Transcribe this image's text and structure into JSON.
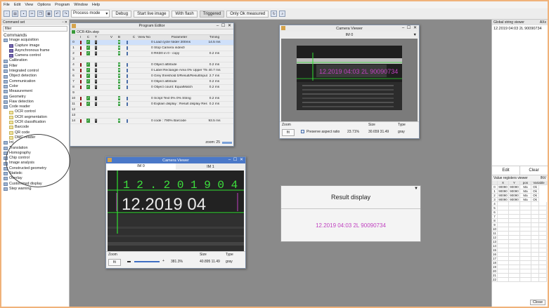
{
  "menu": [
    "File",
    "Edit",
    "View",
    "Options",
    "Program",
    "Window",
    "Help"
  ],
  "toolbar": {
    "icons": [
      "new-icon",
      "open-icon",
      "save-icon",
      "cut-icon",
      "copy-icon",
      "paste-icon",
      "undo-icon",
      "redo-icon"
    ],
    "mode_select": "Process mode",
    "debug_btn": "Debug",
    "start_live_btn": "Start live image",
    "flash_btn": "With flash",
    "triggered_btn": "Triggered",
    "only_ok_btn": "Only Ok measured"
  },
  "left_panel": {
    "title": "Command set",
    "filter": "filter",
    "items": [
      {
        "label": "Commands",
        "level": 0,
        "icon": "none",
        "kind": "hdr"
      },
      {
        "label": "Image acquisition",
        "level": 0,
        "icon": "folder-icon"
      },
      {
        "label": "Capture image",
        "level": 1,
        "icon": "image-icon"
      },
      {
        "label": "Asynchronous frame",
        "level": 1,
        "icon": "image-icon"
      },
      {
        "label": "Camera control",
        "level": 1,
        "icon": "image-icon"
      },
      {
        "label": "Calibration",
        "level": 0,
        "icon": "folder-icon"
      },
      {
        "label": "Filter",
        "level": 0,
        "icon": "folder-icon"
      },
      {
        "label": "Integrated control",
        "level": 0,
        "icon": "folder-icon"
      },
      {
        "label": "Object detection",
        "level": 0,
        "icon": "folder-icon"
      },
      {
        "label": "Communication",
        "level": 0,
        "icon": "folder-icon"
      },
      {
        "label": "Color",
        "level": 0,
        "icon": "folder-icon"
      },
      {
        "label": "Measurement",
        "level": 0,
        "icon": "folder-icon"
      },
      {
        "label": "Geometry",
        "level": 0,
        "icon": "folder-icon"
      },
      {
        "label": "Flaw detection",
        "level": 0,
        "icon": "folder-icon"
      },
      {
        "label": "Code reader",
        "level": 0,
        "icon": "folder-icon"
      },
      {
        "label": "OCR control",
        "level": 1,
        "icon": "code-icon"
      },
      {
        "label": "OCR segmentation",
        "level": 1,
        "icon": "code-icon"
      },
      {
        "label": "OCR classification",
        "level": 1,
        "icon": "code-icon"
      },
      {
        "label": "Barcode",
        "level": 1,
        "icon": "code-icon"
      },
      {
        "label": "QR code",
        "level": 1,
        "icon": "code-icon"
      },
      {
        "label": "DMC reader",
        "level": 1,
        "icon": "code-icon"
      },
      {
        "label": "Int",
        "level": 0,
        "icon": "folder-icon"
      },
      {
        "label": "Translation",
        "level": 0,
        "icon": "folder-icon"
      },
      {
        "label": "Homography",
        "level": 0,
        "icon": "folder-icon"
      },
      {
        "label": "Chip control",
        "level": 0,
        "icon": "folder-icon"
      },
      {
        "label": "Image analysis",
        "level": 0,
        "icon": "folder-icon"
      },
      {
        "label": "Constructed geometry",
        "level": 0,
        "icon": "folder-icon"
      },
      {
        "label": "Statistic",
        "level": 0,
        "icon": "folder-icon"
      },
      {
        "label": "Overlay",
        "level": 0,
        "icon": "folder-icon"
      },
      {
        "label": "Customized display",
        "level": 0,
        "icon": "folder-icon"
      },
      {
        "label": "Step warning",
        "level": 0,
        "icon": "folder-icon"
      }
    ]
  },
  "program_editor": {
    "title": "Program Editor",
    "file": "OCR-Kiln.step",
    "headers": [
      "I",
      "C",
      "T",
      "",
      "V",
      "B",
      "",
      "C",
      "View No",
      "Parameter",
      "Timing"
    ],
    "rows": [
      {
        "n": "0",
        "text": "0 Load cycle folder 200ms",
        "t": "14.5 ms",
        "sel": true
      },
      {
        "n": "1",
        "text": "0 Stop Camera index0",
        "t": "",
        "sel": false
      },
      {
        "n": "2",
        "text": "0 RKD0 in 0 - copy",
        "t": "0.2 ms",
        "sel": false
      },
      {
        "n": "3",
        "text": "",
        "t": "",
        "sel": false
      },
      {
        "n": "4",
        "text": "0 Object attribute",
        "t": "0.2 ms",
        "sel": false
      },
      {
        "n": "5",
        "text": "0 Label Rectangle Area 0% Upper Threshold",
        "t": "40.7 ms",
        "sel": false
      },
      {
        "n": "6",
        "text": "0 Grey threshold 0/Result/ResultInput",
        "t": "2.7 ms",
        "sel": false
      },
      {
        "n": "7",
        "text": "0 Object attribute",
        "t": "0.2 ms",
        "sel": false
      },
      {
        "n": "8",
        "text": "0 Object count: EqualMatch",
        "t": "0.2 ms",
        "sel": false
      },
      {
        "n": "9",
        "text": "",
        "t": "",
        "sel": false
      },
      {
        "n": "10",
        "text": "0 Script Text 0% 0% String",
        "t": "0.2 ms",
        "sel": false
      },
      {
        "n": "11",
        "text": "0 Explain display : Result display Result",
        "t": "0.2 ms",
        "sel": false
      },
      {
        "n": "12",
        "text": "",
        "t": "",
        "sel": false
      },
      {
        "n": "13",
        "text": "",
        "t": "",
        "sel": false
      },
      {
        "n": "14",
        "text": "0 code : 790% Barcode",
        "t": "93.5 ms",
        "sel": false
      }
    ],
    "zoom": "zoom: 25"
  },
  "camera_viewer": {
    "title": "Camera Viewer",
    "tab": "IM 0",
    "image_text": "12.2019 04:03 2L 90090734",
    "zoom_label": "Zoom",
    "size_label": "Size",
    "type_label": "Type",
    "fit_btn": "fit",
    "preserve_aspect": "Preserve aspect ratio",
    "zoom_value": "23.71%",
    "size_value": "30.659 31.49",
    "type_value": "gray"
  },
  "camera_viewer2": {
    "title": "Camera Viewer",
    "tabs": [
      "IM 0",
      "IM 1"
    ],
    "line1": "1 2 . 2 0 1 9     0 4",
    "line2": "12.2019 04",
    "zoom_label": "Zoom",
    "size_label": "Size",
    "type_label": "Type",
    "fit_btn": "fit",
    "zoom_value": "381.3%",
    "size_value": "40.895 11.49",
    "type_value": "gray"
  },
  "result_display": {
    "title": "Result display",
    "value": "12.2019 04:03 2L 90090734",
    "accent": "#c040c0"
  },
  "right_panel": {
    "title": "Global string viewer",
    "title_right": "AXx",
    "value": "12.2019 04:03 2L 90090734",
    "edit_btn": "Edit",
    "clear_btn": "Clear",
    "sub_title": "Value registers viewer",
    "sub_right": "INV",
    "cols": [
      "X",
      "Y",
      "pos",
      "Variable"
    ],
    "rows": [
      [
        "0",
        "90090",
        "90090",
        "Ma",
        "Ok"
      ],
      [
        "1",
        "90090",
        "90090",
        "Ma",
        "Ok"
      ],
      [
        "2",
        "90090",
        "90090",
        "Ma",
        "Ok"
      ],
      [
        "3",
        "90090",
        "90090",
        "Ma",
        "Ok"
      ]
    ],
    "empty_rows": [
      "4",
      "5",
      "6",
      "7",
      "8",
      "9",
      "10",
      "11",
      "12",
      "13",
      "14",
      "15",
      "16",
      "17",
      "18",
      "19",
      "20",
      "21",
      "22"
    ],
    "close_btn": "Close"
  },
  "colors": {
    "accent_ocr": "#c040c0",
    "grid_green": "#31e031",
    "window_border": "#7f8ea3"
  }
}
